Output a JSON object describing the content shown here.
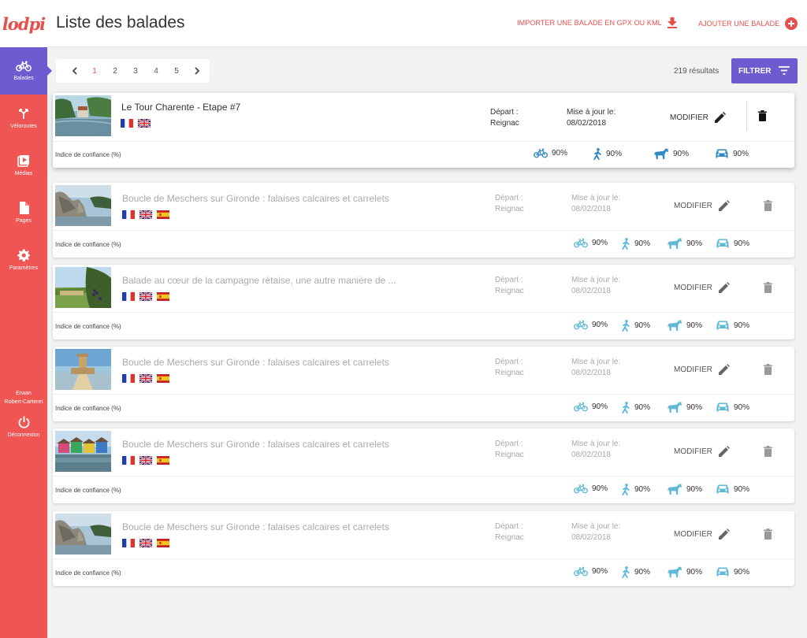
{
  "app": {
    "logo": "lodpi",
    "title": "Liste des balades"
  },
  "header": {
    "import_label": "IMPORTER UNE BALADE EN GPX OU KML",
    "add_label": "AJOUTER UNE BALADE"
  },
  "sidebar": {
    "items": [
      {
        "label": "Balades",
        "icon": "bike-icon",
        "active": true
      },
      {
        "label": "Véloroutes",
        "icon": "route-icon",
        "active": false
      },
      {
        "label": "Médias",
        "icon": "media-icon",
        "active": false
      },
      {
        "label": "Pages",
        "icon": "page-icon",
        "active": false
      },
      {
        "label": "Paramètres",
        "icon": "gear-icon",
        "active": false
      }
    ],
    "user": {
      "first": "Erwan",
      "last": "Robert-Carteret"
    },
    "logout_label": "Déconnexion"
  },
  "pagination": {
    "pages": [
      "1",
      "2",
      "3",
      "4",
      "5"
    ],
    "current": "1"
  },
  "results_label": "219 résultats",
  "filter_label": "FILTRER",
  "labels": {
    "depart": "Départ :",
    "update": "Mise à jour le:",
    "edit": "MODIFIER",
    "confidence": "Indice de confiance (%)"
  },
  "colors": {
    "brand": "#ef5552",
    "accent": "#6c5ccf",
    "icon_active": "#2f8ac4",
    "icon_muted": "#5fbad8"
  },
  "balades": [
    {
      "title": "Le Tour Charente - Etape #7",
      "flags": [
        "fr",
        "gb"
      ],
      "depart": "Reignac",
      "date": "08/02/2018",
      "bike": "90%",
      "walk": "90%",
      "horse": "90%",
      "car": "90%",
      "photo": "river"
    },
    {
      "title": "Boucle de Meschers sur Gironde : falaises calcaires et carrelets",
      "flags": [
        "fr",
        "gb",
        "es"
      ],
      "depart": "Reignac",
      "date": "08/02/2018",
      "bike": "90%",
      "walk": "90%",
      "horse": "90%",
      "car": "90%",
      "photo": "cliff"
    },
    {
      "title": "Balade au cœur de la campagne rétaise, une autre manière de ...",
      "flags": [
        "fr",
        "gb",
        "es"
      ],
      "depart": "Reignac",
      "date": "08/02/2018",
      "bike": "90%",
      "walk": "90%",
      "horse": "90%",
      "car": "90%",
      "photo": "vine"
    },
    {
      "title": "Boucle de Meschers sur Gironde : falaises calcaires et carrelets",
      "flags": [
        "fr",
        "gb",
        "es"
      ],
      "depart": "Reignac",
      "date": "08/02/2018",
      "bike": "90%",
      "walk": "90%",
      "horse": "90%",
      "car": "90%",
      "photo": "fort"
    },
    {
      "title": "Boucle de Meschers sur Gironde : falaises calcaires et carrelets",
      "flags": [
        "fr",
        "gb",
        "es"
      ],
      "depart": "Reignac",
      "date": "08/02/2018",
      "bike": "90%",
      "walk": "90%",
      "horse": "90%",
      "car": "90%",
      "photo": "huts"
    },
    {
      "title": "Boucle de Meschers sur Gironde : falaises calcaires et carrelets",
      "flags": [
        "fr",
        "gb",
        "es"
      ],
      "depart": "Reignac",
      "date": "08/02/2018",
      "bike": "90%",
      "walk": "90%",
      "horse": "90%",
      "car": "90%",
      "photo": "cliff"
    }
  ]
}
